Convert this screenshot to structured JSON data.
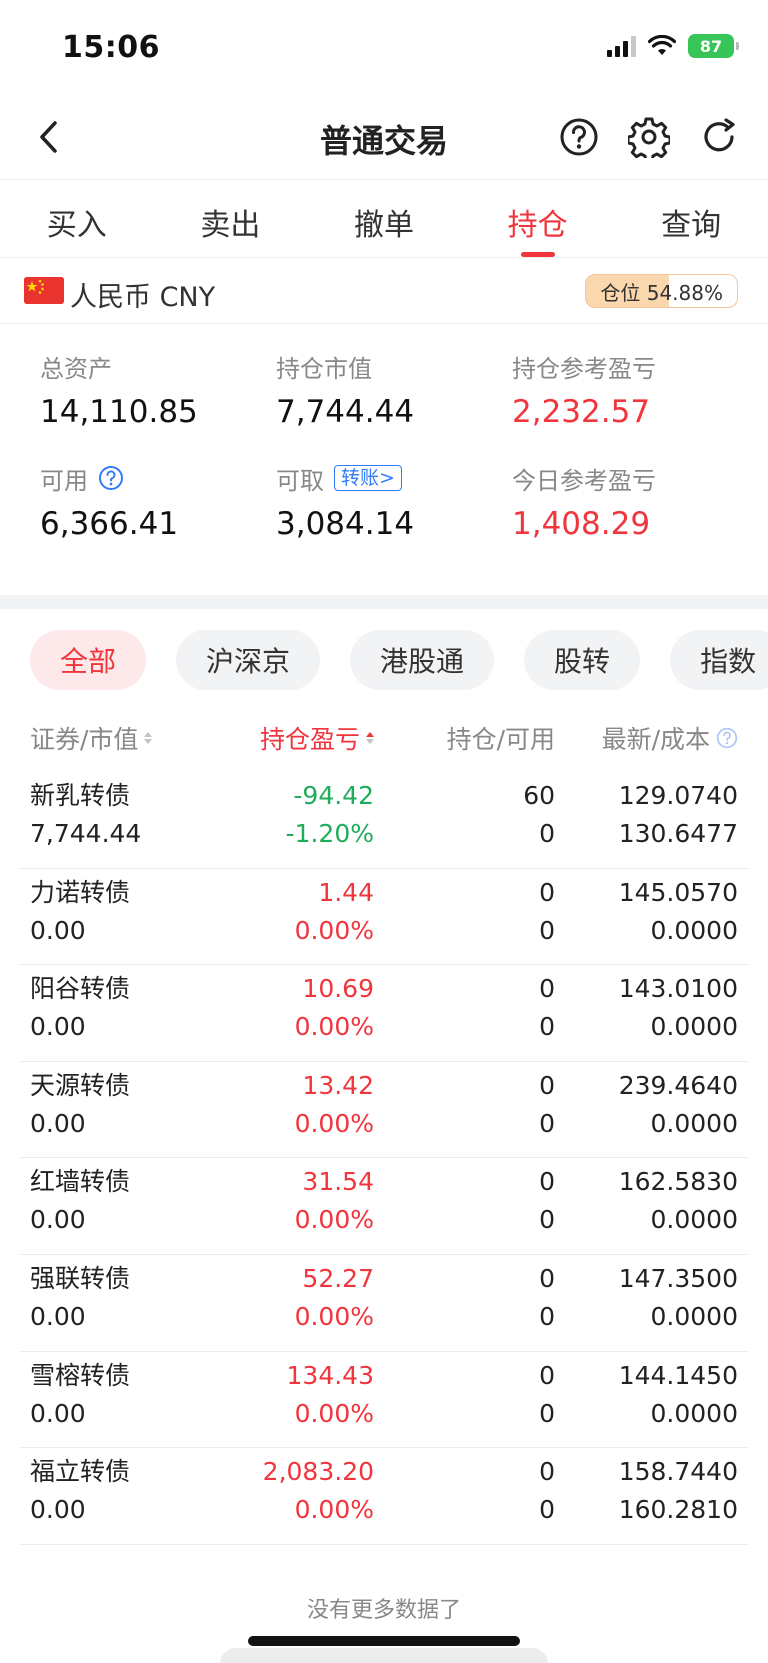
{
  "status_bar": {
    "time": "15:06",
    "battery": "87"
  },
  "nav": {
    "title": "普通交易"
  },
  "tabs": [
    {
      "label": "买入",
      "active": false
    },
    {
      "label": "卖出",
      "active": false
    },
    {
      "label": "撤单",
      "active": false
    },
    {
      "label": "持仓",
      "active": true
    },
    {
      "label": "查询",
      "active": false
    }
  ],
  "currency": {
    "label": "人民币 CNY",
    "position_ratio_text": "仓位 54.88%",
    "position_ratio": 0.5488
  },
  "summary": {
    "total_assets": {
      "label": "总资产",
      "value": "14,110.85"
    },
    "market_value": {
      "label": "持仓市值",
      "value": "7,744.44"
    },
    "position_pnl": {
      "label": "持仓参考盈亏",
      "value": "2,232.57"
    },
    "available": {
      "label": "可用",
      "value": "6,366.41"
    },
    "withdrawable": {
      "label": "可取",
      "value": "3,084.14",
      "link": "转账>"
    },
    "today_pnl": {
      "label": "今日参考盈亏",
      "value": "1,408.29"
    }
  },
  "filters": [
    {
      "label": "全部",
      "active": true
    },
    {
      "label": "沪深京",
      "active": false
    },
    {
      "label": "港股通",
      "active": false
    },
    {
      "label": "股转",
      "active": false
    },
    {
      "label": "指数",
      "active": false
    }
  ],
  "list_header": {
    "col1": "证券/市值",
    "col2": "持仓盈亏",
    "col3": "持仓/可用",
    "col4": "最新/成本"
  },
  "holdings": [
    {
      "name": "新乳转债",
      "market_value": "7,744.44",
      "pnl": "-94.42",
      "pnl_pct": "-1.20%",
      "qty": "60",
      "available": "0",
      "last": "129.0740",
      "cost": "130.6477",
      "color": "green"
    },
    {
      "name": "力诺转债",
      "market_value": "0.00",
      "pnl": "1.44",
      "pnl_pct": "0.00%",
      "qty": "0",
      "available": "0",
      "last": "145.0570",
      "cost": "0.0000",
      "color": "red"
    },
    {
      "name": "阳谷转债",
      "market_value": "0.00",
      "pnl": "10.69",
      "pnl_pct": "0.00%",
      "qty": "0",
      "available": "0",
      "last": "143.0100",
      "cost": "0.0000",
      "color": "red"
    },
    {
      "name": "天源转债",
      "market_value": "0.00",
      "pnl": "13.42",
      "pnl_pct": "0.00%",
      "qty": "0",
      "available": "0",
      "last": "239.4640",
      "cost": "0.0000",
      "color": "red"
    },
    {
      "name": "红墙转债",
      "market_value": "0.00",
      "pnl": "31.54",
      "pnl_pct": "0.00%",
      "qty": "0",
      "available": "0",
      "last": "162.5830",
      "cost": "0.0000",
      "color": "red"
    },
    {
      "name": "强联转债",
      "market_value": "0.00",
      "pnl": "52.27",
      "pnl_pct": "0.00%",
      "qty": "0",
      "available": "0",
      "last": "147.3500",
      "cost": "0.0000",
      "color": "red"
    },
    {
      "name": "雪榕转债",
      "market_value": "0.00",
      "pnl": "134.43",
      "pnl_pct": "0.00%",
      "qty": "0",
      "available": "0",
      "last": "144.1450",
      "cost": "0.0000",
      "color": "red"
    },
    {
      "name": "福立转债",
      "market_value": "0.00",
      "pnl": "2,083.20",
      "pnl_pct": "0.00%",
      "qty": "0",
      "available": "0",
      "last": "158.7440",
      "cost": "160.2810",
      "color": "red"
    }
  ],
  "footer": {
    "no_more": "没有更多数据了"
  },
  "colors": {
    "accent_red": "#f0353c",
    "profit_green": "#1fad5c",
    "link_blue": "#2f7cf6"
  }
}
